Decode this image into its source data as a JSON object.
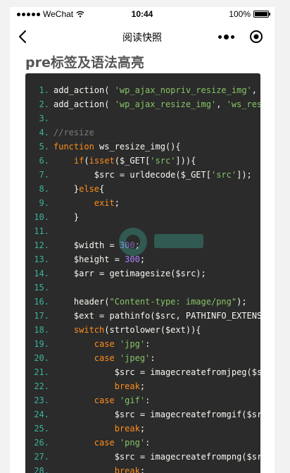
{
  "status_bar": {
    "carrier": "WeChat",
    "time": "10:44",
    "battery": "100%",
    "battery_level": 1.0
  },
  "nav": {
    "title": "阅读快照",
    "icons": [
      "back-chevron-icon",
      "more-dots-icon",
      "record-circle-icon"
    ]
  },
  "article": {
    "heading": "pre标签及语法高亮"
  },
  "colors": {
    "code_bg": "#2b2b2b",
    "line_number": "#3bb39b",
    "keyword": "#ff8d1c",
    "string": "#86c466",
    "comment": "#7b7b7b",
    "number": "#ae81ff",
    "plain": "#f8f8f2"
  },
  "code": {
    "lines": [
      {
        "n": "1.",
        "tokens": [
          {
            "t": "add_action( "
          },
          {
            "t": "'wp_ajax_nopriv_resize_img'",
            "c": "str"
          },
          {
            "t": ", '"
          }
        ]
      },
      {
        "n": "2.",
        "tokens": [
          {
            "t": "add_action( "
          },
          {
            "t": "'wp_ajax_resize_img'",
            "c": "str"
          },
          {
            "t": ", "
          },
          {
            "t": "'ws_resi",
            "c": "str"
          }
        ]
      },
      {
        "n": "3.",
        "tokens": []
      },
      {
        "n": "4.",
        "tokens": [
          {
            "t": "//resize",
            "c": "cm"
          }
        ]
      },
      {
        "n": "5.",
        "tokens": [
          {
            "t": "function",
            "c": "kw"
          },
          {
            "t": " ws_resize_img(){"
          }
        ]
      },
      {
        "n": "6.",
        "tokens": [
          {
            "t": "    "
          },
          {
            "t": "if",
            "c": "kw"
          },
          {
            "t": "("
          },
          {
            "t": "isset",
            "c": "kw"
          },
          {
            "t": "($_GET["
          },
          {
            "t": "'src'",
            "c": "str"
          },
          {
            "t": "])){"
          }
        ]
      },
      {
        "n": "7.",
        "tokens": [
          {
            "t": "        $src = urldecode($_GET["
          },
          {
            "t": "'src'",
            "c": "str"
          },
          {
            "t": "]);"
          }
        ]
      },
      {
        "n": "8.",
        "tokens": [
          {
            "t": "    }"
          },
          {
            "t": "else",
            "c": "kw"
          },
          {
            "t": "{"
          }
        ]
      },
      {
        "n": "9.",
        "tokens": [
          {
            "t": "        "
          },
          {
            "t": "exit",
            "c": "kw"
          },
          {
            "t": ";"
          }
        ]
      },
      {
        "n": "10.",
        "tokens": [
          {
            "t": "    }"
          }
        ]
      },
      {
        "n": "11.",
        "tokens": []
      },
      {
        "n": "12.",
        "tokens": [
          {
            "t": "    $width = "
          },
          {
            "t": "300",
            "c": "num"
          },
          {
            "t": ";"
          }
        ]
      },
      {
        "n": "13.",
        "tokens": [
          {
            "t": "    $height = "
          },
          {
            "t": "300",
            "c": "num"
          },
          {
            "t": ";"
          }
        ]
      },
      {
        "n": "14.",
        "tokens": [
          {
            "t": "    $arr = getimagesize($src);"
          }
        ]
      },
      {
        "n": "15.",
        "tokens": []
      },
      {
        "n": "16.",
        "tokens": [
          {
            "t": "    header("
          },
          {
            "t": "\"Content-type: image/png\"",
            "c": "str"
          },
          {
            "t": ");"
          }
        ]
      },
      {
        "n": "17.",
        "tokens": [
          {
            "t": "    $ext = pathinfo($src, PATHINFO_EXTENSI"
          }
        ]
      },
      {
        "n": "18.",
        "tokens": [
          {
            "t": "    "
          },
          {
            "t": "switch",
            "c": "kw"
          },
          {
            "t": "(strtolower($ext)){"
          }
        ]
      },
      {
        "n": "19.",
        "tokens": [
          {
            "t": "        "
          },
          {
            "t": "case",
            "c": "kw"
          },
          {
            "t": " "
          },
          {
            "t": "'jpg'",
            "c": "str"
          },
          {
            "t": ":"
          }
        ]
      },
      {
        "n": "20.",
        "tokens": [
          {
            "t": "        "
          },
          {
            "t": "case",
            "c": "kw"
          },
          {
            "t": " "
          },
          {
            "t": "'jpeg'",
            "c": "str"
          },
          {
            "t": ":"
          }
        ]
      },
      {
        "n": "21.",
        "tokens": [
          {
            "t": "            $src = imagecreatefromjpeg($sr"
          }
        ]
      },
      {
        "n": "22.",
        "tokens": [
          {
            "t": "            "
          },
          {
            "t": "break",
            "c": "kw"
          },
          {
            "t": ";"
          }
        ]
      },
      {
        "n": "23.",
        "tokens": [
          {
            "t": "        "
          },
          {
            "t": "case",
            "c": "kw"
          },
          {
            "t": " "
          },
          {
            "t": "'gif'",
            "c": "str"
          },
          {
            "t": ":"
          }
        ]
      },
      {
        "n": "24.",
        "tokens": [
          {
            "t": "            $src = imagecreatefromgif($src"
          }
        ]
      },
      {
        "n": "25.",
        "tokens": [
          {
            "t": "            "
          },
          {
            "t": "break",
            "c": "kw"
          },
          {
            "t": ";"
          }
        ]
      },
      {
        "n": "26.",
        "tokens": [
          {
            "t": "        "
          },
          {
            "t": "case",
            "c": "kw"
          },
          {
            "t": " "
          },
          {
            "t": "'png'",
            "c": "str"
          },
          {
            "t": ":"
          }
        ]
      },
      {
        "n": "27.",
        "tokens": [
          {
            "t": "            $src = imagecreatefrompng($src"
          }
        ]
      },
      {
        "n": "28.",
        "tokens": [
          {
            "t": "            "
          },
          {
            "t": "break",
            "c": "kw"
          },
          {
            "t": ";"
          }
        ]
      }
    ]
  }
}
